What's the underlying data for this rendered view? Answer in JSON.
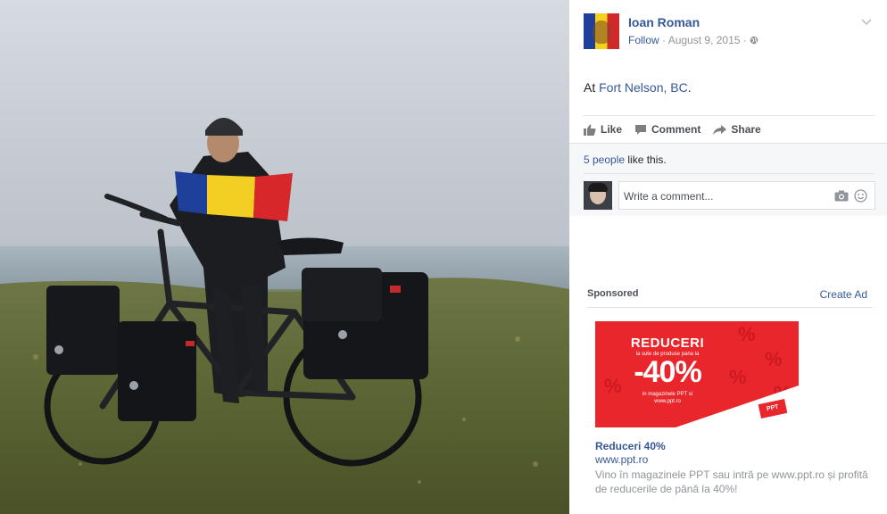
{
  "post": {
    "author": "Ioan Roman",
    "follow": "Follow",
    "separator": "·",
    "date": "August 9, 2015",
    "separator2": "·",
    "location_prefix": "At",
    "location": "Fort Nelson, BC",
    "location_suffix": "."
  },
  "actions": {
    "like": "Like",
    "comment": "Comment",
    "share": "Share"
  },
  "likes": {
    "people": "5 people",
    "suffix": " like this."
  },
  "comment_box": {
    "placeholder": "Write a comment..."
  },
  "sponsored": {
    "label": "Sponsored",
    "create_ad": "Create Ad",
    "image_text": {
      "headline": "REDUCERI",
      "sub": "la sute de produse pana la",
      "percent": "-40%",
      "small": "in magazinele PPT si",
      "url": "www.ppt.ro",
      "logo": "PPT"
    },
    "ad_title": "Reduceri 40%",
    "ad_url": "www.ppt.ro",
    "ad_description": "Vino în magazinele PPT sau intră pe www.ppt.ro și profită de reducerile de până la 40%!"
  },
  "colors": {
    "link": "#365899",
    "muted": "#90949c",
    "ad_red": "#e8262b"
  },
  "icons": [
    "chevron-down-icon",
    "globe-icon",
    "like-icon",
    "comment-icon",
    "share-icon",
    "camera-icon",
    "smiley-icon"
  ]
}
